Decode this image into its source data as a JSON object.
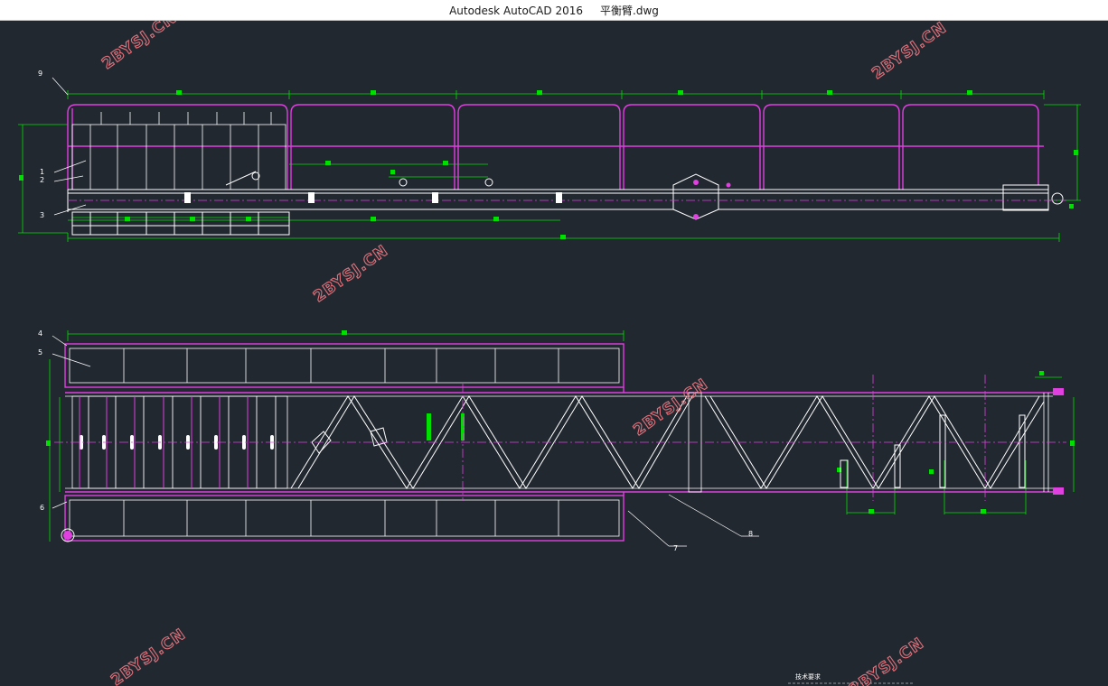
{
  "window": {
    "title": "Autodesk AutoCAD 2016     平衡臂.dwg"
  },
  "drawing": {
    "part_labels": [
      "9",
      "1",
      "2",
      "3",
      "4",
      "5",
      "6",
      "7",
      "8"
    ],
    "note_heading": "技术要求"
  },
  "watermark": {
    "text": "2BYSJ.CN"
  },
  "colors": {
    "background": "#212830",
    "outline": "#ffffff",
    "member": "#e040e0",
    "dimension": "#00e000",
    "watermark": "#e0707a"
  }
}
